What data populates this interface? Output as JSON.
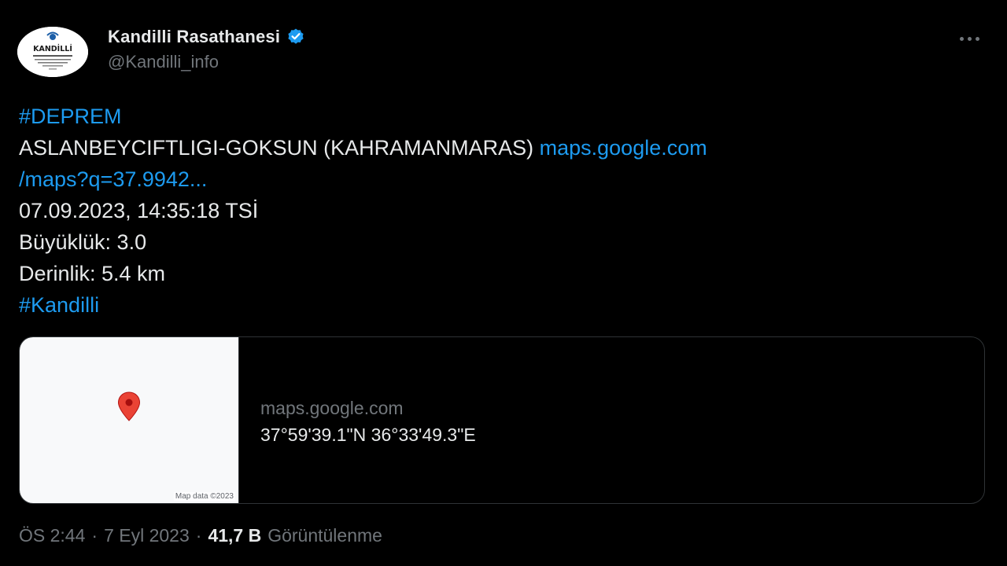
{
  "header": {
    "display_name": "Kandilli Rasathanesi",
    "handle": "@Kandilli_info",
    "avatar_text": "KANDİLLİ",
    "verified_icon": "verified-badge-icon",
    "more_icon": "more-horizontal-icon"
  },
  "body": {
    "hashtag_deprem": "#DEPREM",
    "location": "ASLANBEYCIFTLIGI-GOKSUN (KAHRAMANMARAS)",
    "link_part1": "maps.google.com",
    "link_part2": "/maps?q=37.9942...",
    "datetime": "07.09.2023, 14:35:18 TSİ",
    "magnitude": "Büyüklük: 3.0",
    "depth": "Derinlik: 5.4 km",
    "hashtag_kandilli": "#Kandilli"
  },
  "card": {
    "domain": "maps.google.com",
    "title": "37°59'39.1\"N 36°33'49.3\"E",
    "map_attribution": "Map data ©2023",
    "pin_icon": "map-pin-icon"
  },
  "footer": {
    "time": "ÖS 2:44",
    "date": "7 Eyl 2023",
    "separator": "·",
    "views_count": "41,7 B",
    "views_label": "Görüntülenme"
  },
  "colors": {
    "background": "#000000",
    "text": "#e7e9ea",
    "secondary": "#71767b",
    "link": "#1d9bf0",
    "border": "#2f3336",
    "verified": "#1d9bf0",
    "pin": "#ea4335"
  }
}
